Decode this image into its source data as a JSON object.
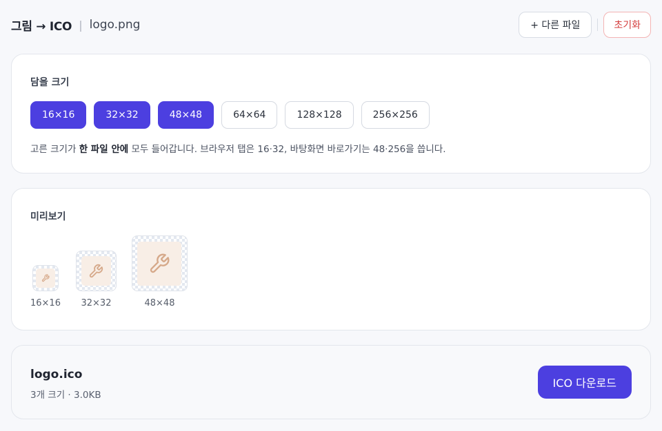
{
  "header": {
    "title": "그림 → ICO",
    "separator": "|",
    "filename": "logo.png",
    "other_file_button": "+ 다른 파일",
    "reset_button": "초기화"
  },
  "sizes": {
    "title": "담을 크기",
    "options": [
      {
        "label": "16×16",
        "selected": true
      },
      {
        "label": "32×32",
        "selected": true
      },
      {
        "label": "48×48",
        "selected": true
      },
      {
        "label": "64×64",
        "selected": false
      },
      {
        "label": "128×128",
        "selected": false
      },
      {
        "label": "256×256",
        "selected": false
      }
    ],
    "hint_prefix": "고른 크기가 ",
    "hint_bold": "한 파일 안에",
    "hint_suffix": " 모두 들어갑니다. 브라우저 탭은 16·32, 바탕화면 바로가기는 48·256을 씁니다."
  },
  "preview": {
    "title": "미리보기",
    "items": [
      {
        "label": "16×16",
        "icon": "wrench-icon"
      },
      {
        "label": "32×32",
        "icon": "wrench-icon"
      },
      {
        "label": "48×48",
        "icon": "wrench-icon"
      }
    ]
  },
  "download": {
    "filename": "logo.ico",
    "meta": "3개 크기 · 3.0KB",
    "button": "ICO 다운로드"
  },
  "colors": {
    "accent": "#4c3fe0",
    "danger": "#d33a3a",
    "icon": "#d6a98a",
    "icon_bg": "#f8eee6"
  }
}
